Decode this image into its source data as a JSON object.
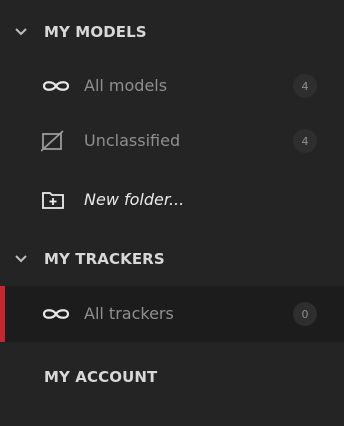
{
  "sections": {
    "models": {
      "title": "MY MODELS",
      "items": [
        {
          "label": "All models",
          "count": "4"
        },
        {
          "label": "Unclassified",
          "count": "4"
        },
        {
          "label": "New folder..."
        }
      ]
    },
    "trackers": {
      "title": "MY TRACKERS",
      "items": [
        {
          "label": "All trackers",
          "count": "0"
        }
      ]
    },
    "account": {
      "title": "MY ACCOUNT"
    }
  },
  "colors": {
    "accent": "#c4272d",
    "background": "#242424"
  },
  "icons": [
    "chevron-down-icon",
    "infinity-icon",
    "unclassified-icon",
    "new-folder-icon"
  ]
}
